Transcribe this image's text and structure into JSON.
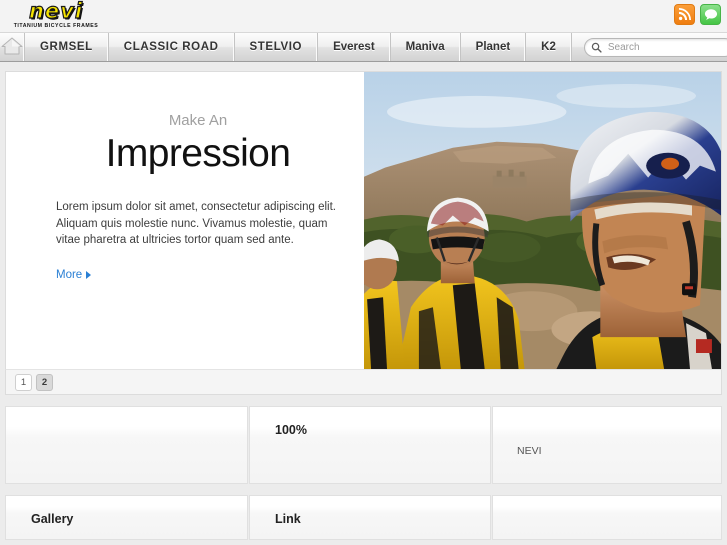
{
  "brand": {
    "logo_word": "nevi",
    "tagline": "TITANIUM BICYCLE FRAMES",
    "logo_color": "#f5e400",
    "logo_outline": "#111111"
  },
  "social": [
    {
      "name": "rss-icon",
      "label": "RSS Feed",
      "color": "#ef7d10"
    },
    {
      "name": "chat-icon",
      "label": "Chat",
      "color": "#45c545"
    }
  ],
  "nav": {
    "home_label": "Home",
    "items": [
      {
        "label": "GRMSEL"
      },
      {
        "label": "CLASSIC ROAD"
      },
      {
        "label": "STELVIO"
      },
      {
        "label": "Everest"
      },
      {
        "label": "Maniva"
      },
      {
        "label": "Planet"
      },
      {
        "label": "K2"
      }
    ]
  },
  "search": {
    "placeholder": "Search",
    "value": ""
  },
  "hero": {
    "eyebrow": "Make An",
    "title": "Impression",
    "paragraph": "Lorem ipsum dolor sit amet, consectetur adipiscing elit. Aliquam quis molestie nunc. Vivamus molestie, quam vitae pharetra at ultricies tortor quam sed ante.",
    "more_label": "More",
    "image_alt": "Two cyclists wearing helmets and yellow NEVI jerseys on a mountain road"
  },
  "pager": {
    "pages": [
      {
        "label": "1",
        "active": false
      },
      {
        "label": "2",
        "active": true
      }
    ]
  },
  "columns_row1": [
    {
      "heading": "",
      "text": ""
    },
    {
      "heading": "100%",
      "text": ""
    },
    {
      "heading": "",
      "text": "NEVI"
    }
  ],
  "columns_row2": [
    {
      "heading": "Gallery",
      "text": ""
    },
    {
      "heading": "Link",
      "text": ""
    },
    {
      "heading": "",
      "text": ""
    }
  ],
  "colors": {
    "page_bg": "#ececec",
    "panel_bg": "#ffffff",
    "link": "#2a7fd4",
    "nav_text": "#343434"
  }
}
